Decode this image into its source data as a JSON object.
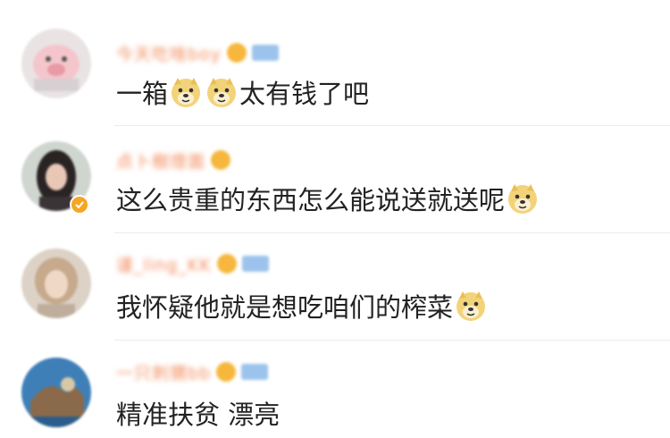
{
  "comments": [
    {
      "username": "今天吃啥boy",
      "avatar_color": "#f4c6cc",
      "text_parts": [
        {
          "type": "text",
          "value": "一箱"
        },
        {
          "type": "emoji",
          "name": "doge-icon"
        },
        {
          "type": "emoji",
          "name": "doge-icon"
        },
        {
          "type": "text",
          "value": "太有钱了吧"
        }
      ],
      "has_vip": true,
      "has_verified": false
    },
    {
      "username": "点卜樹燈面",
      "avatar_color": "#3b3436",
      "text_parts": [
        {
          "type": "text",
          "value": "这么贵重的东西怎么能说送就送呢"
        },
        {
          "type": "emoji",
          "name": "doge-icon"
        }
      ],
      "has_vip": false,
      "has_verified": true
    },
    {
      "username": "谨_ling_KK",
      "avatar_color": "#c7a98c",
      "text_parts": [
        {
          "type": "text",
          "value": "我怀疑他就是想吃咱们的榨菜"
        },
        {
          "type": "emoji",
          "name": "doge-icon"
        }
      ],
      "has_vip": true,
      "has_verified": false
    },
    {
      "username": "一只刺猬bb",
      "avatar_color": "#3f7fb8",
      "text_parts": [
        {
          "type": "text",
          "value": "精准扶贫 漂亮"
        }
      ],
      "has_vip": true,
      "has_verified": false
    }
  ]
}
